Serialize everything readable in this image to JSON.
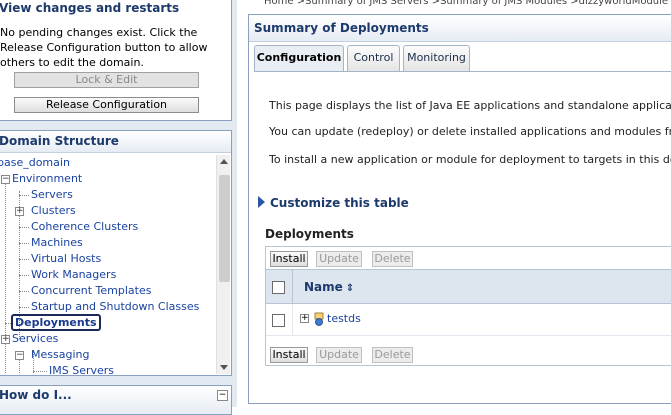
{
  "breadcrumb": "Home >Summary of JMS Servers >Summary of JMS Modules >dizzyworldModule >Summary of",
  "change_center": {
    "title": "View changes and restarts",
    "message": "No pending changes exist. Click the Release Configuration button to allow others to edit the domain.",
    "lock_label": "Lock & Edit",
    "release_label": "Release Configuration"
  },
  "domain_structure": {
    "title": "Domain Structure",
    "items": [
      {
        "label": "base_domain"
      },
      {
        "label": "Environment"
      },
      {
        "label": "Servers"
      },
      {
        "label": "Clusters"
      },
      {
        "label": "Coherence Clusters"
      },
      {
        "label": "Machines"
      },
      {
        "label": "Virtual Hosts"
      },
      {
        "label": "Work Managers"
      },
      {
        "label": "Concurrent Templates"
      },
      {
        "label": "Startup and Shutdown Classes"
      },
      {
        "label": "Deployments"
      },
      {
        "label": "Services"
      },
      {
        "label": "Messaging"
      },
      {
        "label": "JMS Servers"
      }
    ]
  },
  "how_do_i": {
    "title": "How do I..."
  },
  "summary": {
    "title": "Summary of Deployments",
    "tabs": [
      "Configuration",
      "Control",
      "Monitoring"
    ],
    "desc1": "This page displays the list of Java EE applications and standalone application modules",
    "desc2": "You can update (redeploy) or delete installed applications and modules from the domain",
    "desc3": "To install a new application or module for deployment to targets in this domain, click",
    "customize": "Customize this table",
    "deployments_title": "Deployments",
    "buttons": {
      "install": "Install",
      "update": "Update",
      "delete": "Delete"
    },
    "column_name": "Name",
    "rows": [
      "testds"
    ]
  }
}
